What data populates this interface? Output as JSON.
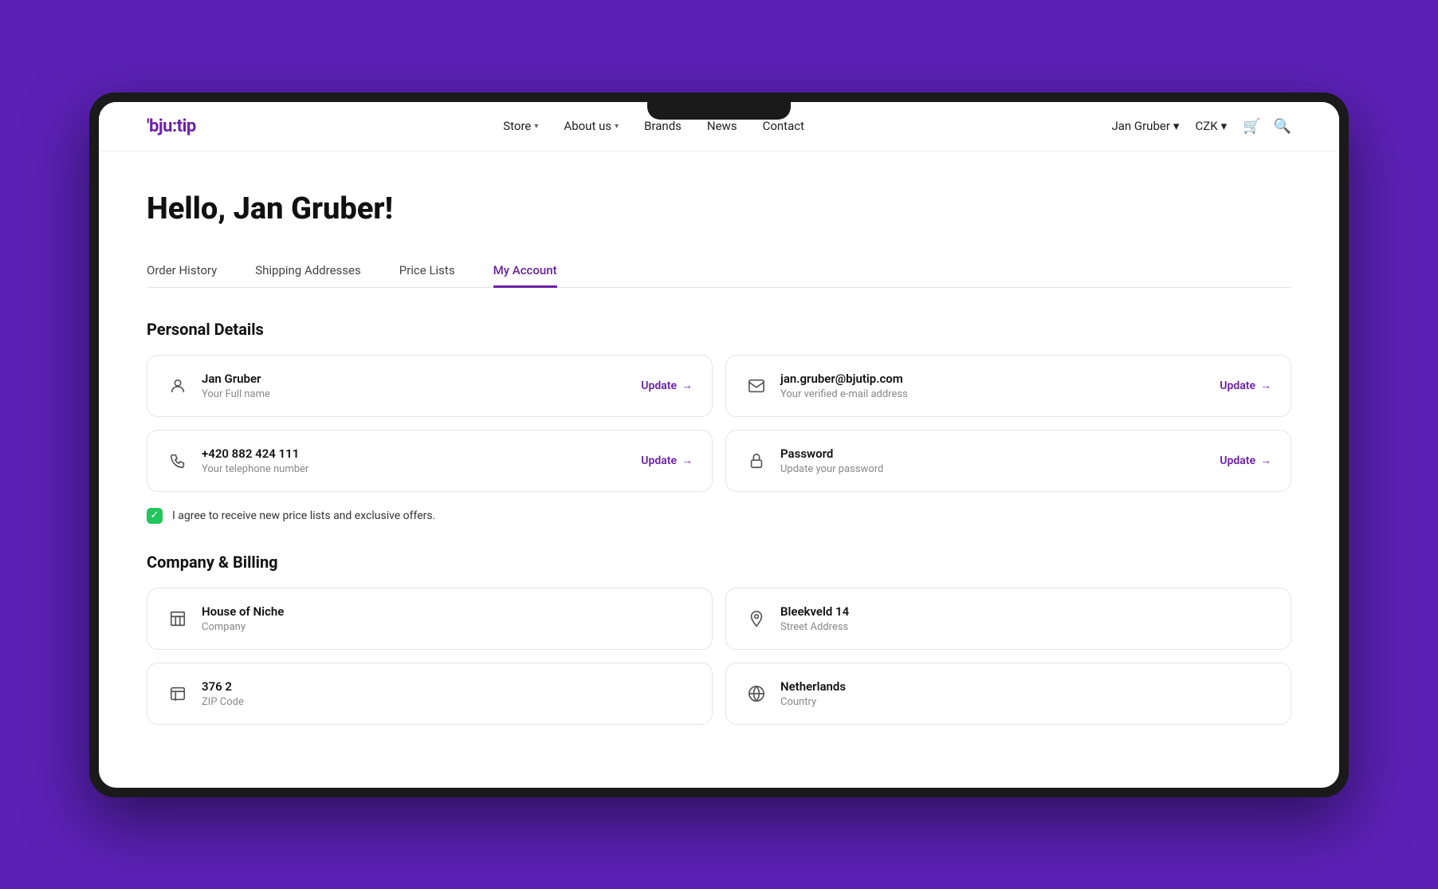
{
  "device": {
    "notch": true
  },
  "nav": {
    "logo": "'bju:tip",
    "links": [
      {
        "label": "Store",
        "hasChevron": true,
        "name": "store"
      },
      {
        "label": "About us",
        "hasChevron": true,
        "name": "about-us"
      },
      {
        "label": "Brands",
        "hasChevron": false,
        "name": "brands"
      },
      {
        "label": "News",
        "hasChevron": false,
        "name": "news"
      },
      {
        "label": "Contact",
        "hasChevron": false,
        "name": "contact"
      }
    ],
    "user": "Jan Gruber",
    "currency": "CZK"
  },
  "page": {
    "greeting": "Hello, Jan Gruber!",
    "tabs": [
      {
        "label": "Order History",
        "active": false,
        "name": "order-history"
      },
      {
        "label": "Shipping Addresses",
        "active": false,
        "name": "shipping-addresses"
      },
      {
        "label": "Price Lists",
        "active": false,
        "name": "price-lists"
      },
      {
        "label": "My Account",
        "active": true,
        "name": "my-account"
      }
    ],
    "personal_details": {
      "title": "Personal Details",
      "cards": [
        {
          "icon": "person",
          "value": "Jan Gruber",
          "label": "Your Full name",
          "update_label": "Update",
          "name": "fullname-card"
        },
        {
          "icon": "email",
          "value": "jan.gruber@bjutip.com",
          "label": "Your verified e-mail address",
          "update_label": "Update",
          "name": "email-card"
        },
        {
          "icon": "phone",
          "value": "+420 882 424 111",
          "label": "Your telephone number",
          "update_label": "Update",
          "name": "phone-card"
        },
        {
          "icon": "lock",
          "value": "Password",
          "label": "Update your password",
          "update_label": "Update",
          "name": "password-card"
        }
      ]
    },
    "checkbox": {
      "label": "I agree to receive new price lists and exclusive offers.",
      "checked": true
    },
    "company_billing": {
      "title": "Company & Billing",
      "cards": [
        {
          "icon": "building",
          "value": "House of Niche",
          "label": "Company",
          "name": "company-card"
        },
        {
          "icon": "location",
          "value": "Bleekveld 14",
          "label": "Street Address",
          "name": "street-card"
        },
        {
          "icon": "zipcode",
          "value": "376 2",
          "label": "ZIP Code",
          "name": "zip-card"
        },
        {
          "icon": "globe",
          "value": "Netherlands",
          "label": "Country",
          "name": "country-card"
        }
      ]
    }
  }
}
